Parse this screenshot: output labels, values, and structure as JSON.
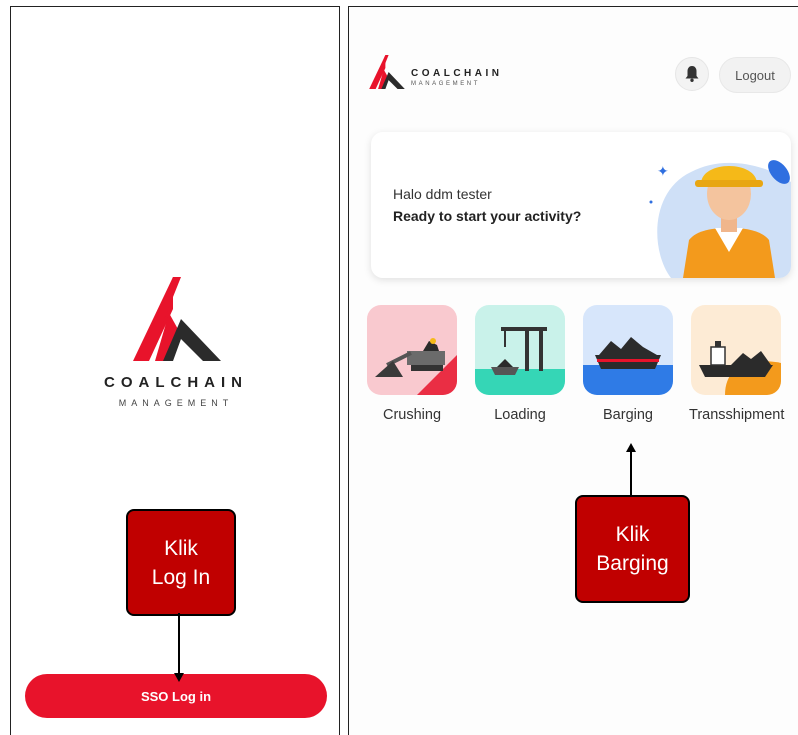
{
  "login_screen": {
    "brand_name": "COALCHAIN",
    "brand_sub": "MANAGEMENT",
    "sso_button_label": "SSO Log in"
  },
  "home_screen": {
    "brand_name": "COALCHAIN",
    "brand_sub": "MANAGEMENT",
    "logout_label": "Logout",
    "greeting_line": "Halo ddm tester",
    "greeting_prompt": "Ready to start your activity?",
    "menu": [
      {
        "label": "Crushing",
        "icon": "crushing-icon",
        "bg": "#f9c9cf"
      },
      {
        "label": "Loading",
        "icon": "loading-icon",
        "bg": "#c9f2ea"
      },
      {
        "label": "Barging",
        "icon": "barging-icon",
        "bg": "#d7e6fb"
      },
      {
        "label": "Transshipment",
        "icon": "transshipment-icon",
        "bg": "#fdebd5"
      }
    ]
  },
  "annotations": {
    "login_callout": [
      "Klik",
      "Log In"
    ],
    "barging_callout": [
      "Klik",
      "Barging"
    ]
  },
  "colors": {
    "brand_red": "#e8132b",
    "callout_red": "#c00000",
    "logo_dark": "#2b2b2b"
  }
}
